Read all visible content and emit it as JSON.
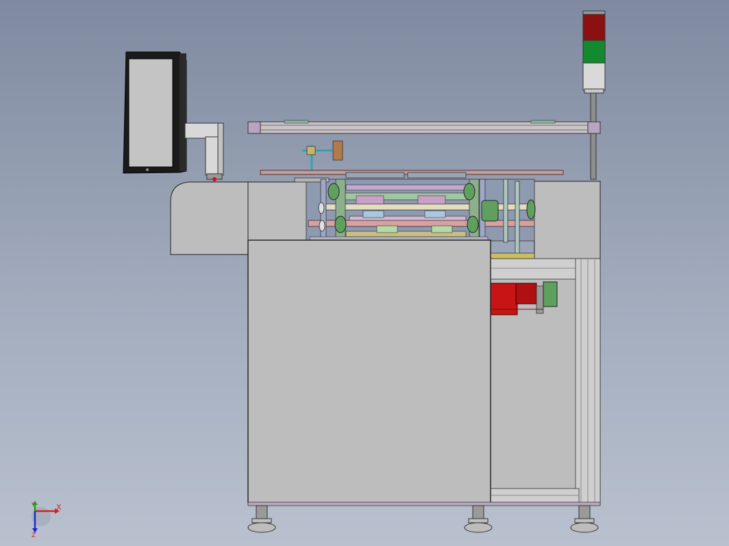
{
  "viewport": {
    "background_top": "#7f8aa0",
    "background_bottom": "#b9c1cf"
  },
  "machine": {
    "body_color": "#bdbdbd",
    "outline_color": "#1e1e1e",
    "motor_color": "#c81414",
    "stack_light": {
      "top_lens_color": "#8b1010",
      "middle_lens_color": "#138a2e",
      "bottom_lens_color": "#d9d9d9"
    }
  },
  "triad": {
    "x_label": "X",
    "y_label": "Y",
    "z_label": "Z"
  }
}
